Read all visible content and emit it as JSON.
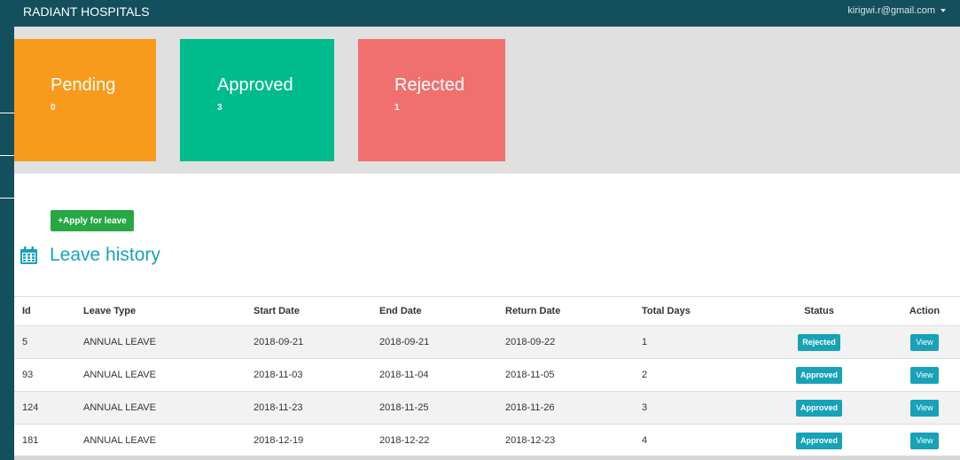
{
  "app": {
    "brand": "RADIANT HOSPITALS",
    "user_email": "kirigwi.r@gmail.com"
  },
  "colors": {
    "navbar": "#134f5c",
    "pending": "#f89a1b",
    "approved": "#00bb8c",
    "rejected": "#f07070",
    "apply_button": "#28a745",
    "accent": "#1ba2b8"
  },
  "stats": [
    {
      "label": "Pending",
      "count": "0"
    },
    {
      "label": "Approved",
      "count": "3"
    },
    {
      "label": "Rejected",
      "count": "1"
    }
  ],
  "actions": {
    "apply_label": "+Apply for leave"
  },
  "section": {
    "title": "Leave history",
    "icon": "calendar-icon"
  },
  "table": {
    "headers": [
      "Id",
      "Leave Type",
      "Start Date",
      "End Date",
      "Return Date",
      "Total Days",
      "Status",
      "Action"
    ],
    "rows": [
      {
        "id": "5",
        "type": "ANNUAL LEAVE",
        "start": "2018-09-21",
        "end": "2018-09-21",
        "return": "2018-09-22",
        "days": "1",
        "status": "Rejected",
        "action": "View"
      },
      {
        "id": "93",
        "type": "ANNUAL LEAVE",
        "start": "2018-11-03",
        "end": "2018-11-04",
        "return": "2018-11-05",
        "days": "2",
        "status": "Approved",
        "action": "View"
      },
      {
        "id": "124",
        "type": "ANNUAL LEAVE",
        "start": "2018-11-23",
        "end": "2018-11-25",
        "return": "2018-11-26",
        "days": "3",
        "status": "Approved",
        "action": "View"
      },
      {
        "id": "181",
        "type": "ANNUAL LEAVE",
        "start": "2018-12-19",
        "end": "2018-12-22",
        "return": "2018-12-23",
        "days": "4",
        "status": "Approved",
        "action": "View"
      }
    ]
  }
}
